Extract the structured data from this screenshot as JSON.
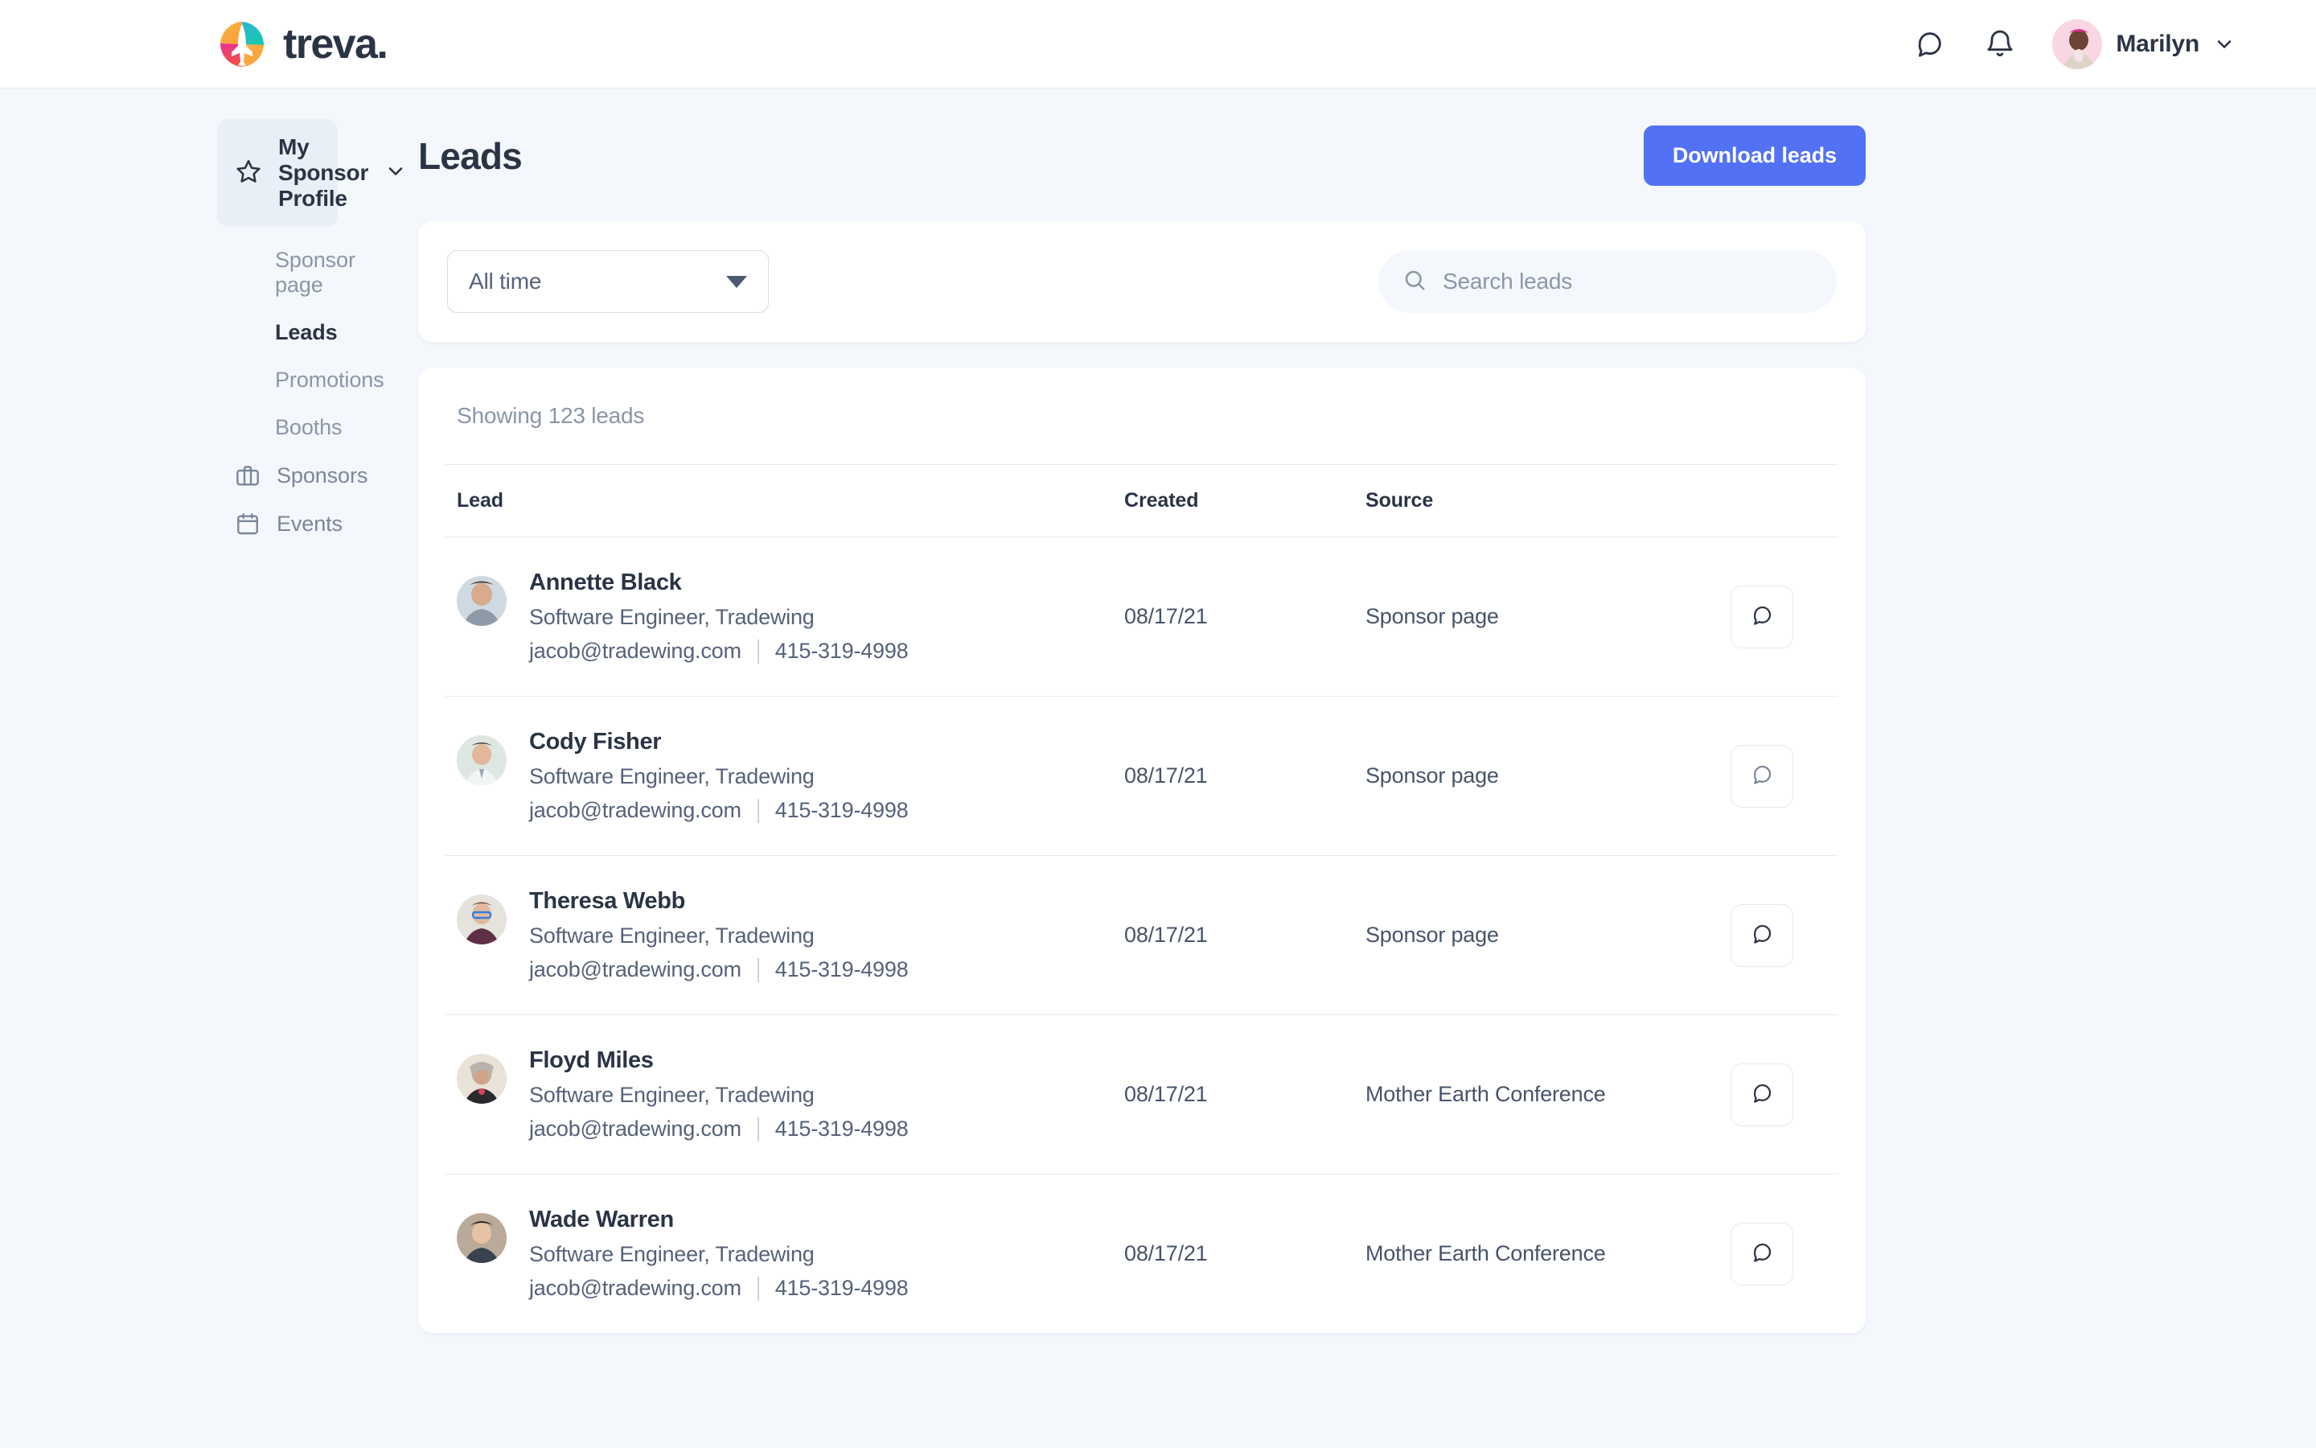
{
  "brand": {
    "word": "treva.",
    "logo_icon": "treva-plane-logo"
  },
  "topbar": {
    "chat_icon": "chat-bubble-icon",
    "bell_icon": "notification-bell-icon",
    "user_name": "Marilyn",
    "chevron_icon": "chevron-down-icon",
    "avatar_icon": "user-avatar"
  },
  "sidebar": {
    "header": {
      "label": "My Sponsor Profile",
      "icon": "star-icon",
      "chevron": "chevron-down-icon"
    },
    "sub_items": [
      {
        "label": "Sponsor page",
        "active": false
      },
      {
        "label": "Leads",
        "active": true
      },
      {
        "label": "Promotions",
        "active": false
      },
      {
        "label": "Booths",
        "active": false
      }
    ],
    "items": [
      {
        "label": "Sponsors",
        "icon": "briefcase-icon"
      },
      {
        "label": "Events",
        "icon": "calendar-icon"
      }
    ]
  },
  "page": {
    "title": "Leads",
    "download_button": "Download leads"
  },
  "filters": {
    "time_range": "All time",
    "search_placeholder": "Search leads",
    "search_value": "",
    "search_icon": "search-icon"
  },
  "table": {
    "showing": "Showing 123 leads",
    "columns": [
      "Lead",
      "Created",
      "Source"
    ],
    "rows": [
      {
        "name": "Annette Black",
        "role": "Software Engineer, Tradewing",
        "email": "jacob@tradewing.com",
        "phone": "415-319-4998",
        "created": "08/17/21",
        "source": "Sponsor page",
        "action_icon": "chat-bubble-icon",
        "action_state": "dark"
      },
      {
        "name": "Cody Fisher",
        "role": "Software Engineer, Tradewing",
        "email": "jacob@tradewing.com",
        "phone": "415-319-4998",
        "created": "08/17/21",
        "source": "Sponsor page",
        "action_icon": "chat-bubble-icon",
        "action_state": "muted"
      },
      {
        "name": "Theresa Webb",
        "role": "Software Engineer, Tradewing",
        "email": "jacob@tradewing.com",
        "phone": "415-319-4998",
        "created": "08/17/21",
        "source": "Sponsor page",
        "action_icon": "chat-bubble-icon",
        "action_state": "dark"
      },
      {
        "name": "Floyd Miles",
        "role": "Software Engineer, Tradewing",
        "email": "jacob@tradewing.com",
        "phone": "415-319-4998",
        "created": "08/17/21",
        "source": "Mother Earth Conference",
        "action_icon": "chat-bubble-icon",
        "action_state": "dark"
      },
      {
        "name": "Wade Warren",
        "role": "Software Engineer, Tradewing",
        "email": "jacob@tradewing.com",
        "phone": "415-319-4998",
        "created": "08/17/21",
        "source": "Mother Earth Conference",
        "action_icon": "chat-bubble-icon",
        "action_state": "dark"
      }
    ]
  },
  "colors": {
    "accent": "#5271f5",
    "page_bg": "#f4f8fc",
    "text": "#2b3445",
    "muted": "#8b96a8"
  }
}
